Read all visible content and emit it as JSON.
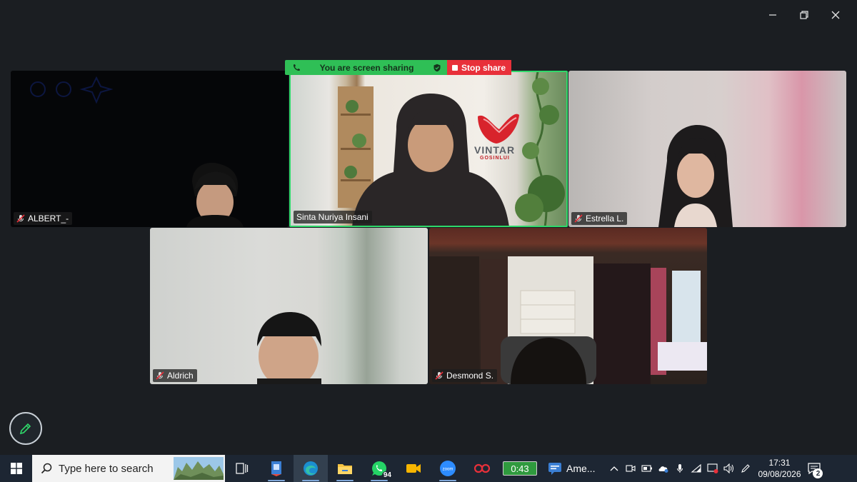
{
  "window_controls": {
    "minimize_icon": "minimize-icon",
    "restore_icon": "restore-icon",
    "close_icon": "close-icon"
  },
  "share_bar": {
    "status_text": "You are screen sharing",
    "stop_label": "Stop share",
    "accent": "#2fbf56",
    "stop_color": "#e8303a"
  },
  "participants": [
    {
      "name": "ALBERT_-",
      "muted": true
    },
    {
      "name": "Sinta Nuriya Insani",
      "muted": false,
      "active_speaker": true
    },
    {
      "name": "Estrella L.",
      "muted": true
    },
    {
      "name": "Aldrich",
      "muted": true
    },
    {
      "name": "Desmond S.",
      "muted": true
    }
  ],
  "background_logo": {
    "brand": "VINTAR",
    "tagline": "GOSINLUI"
  },
  "taskbar": {
    "search_placeholder": "Type here to search",
    "whatsapp_badge": "94",
    "timer": "0:43",
    "ame_label": "Ame...",
    "clock_time": "17:31",
    "clock_date": "09/08/2026",
    "notification_count": "2"
  }
}
